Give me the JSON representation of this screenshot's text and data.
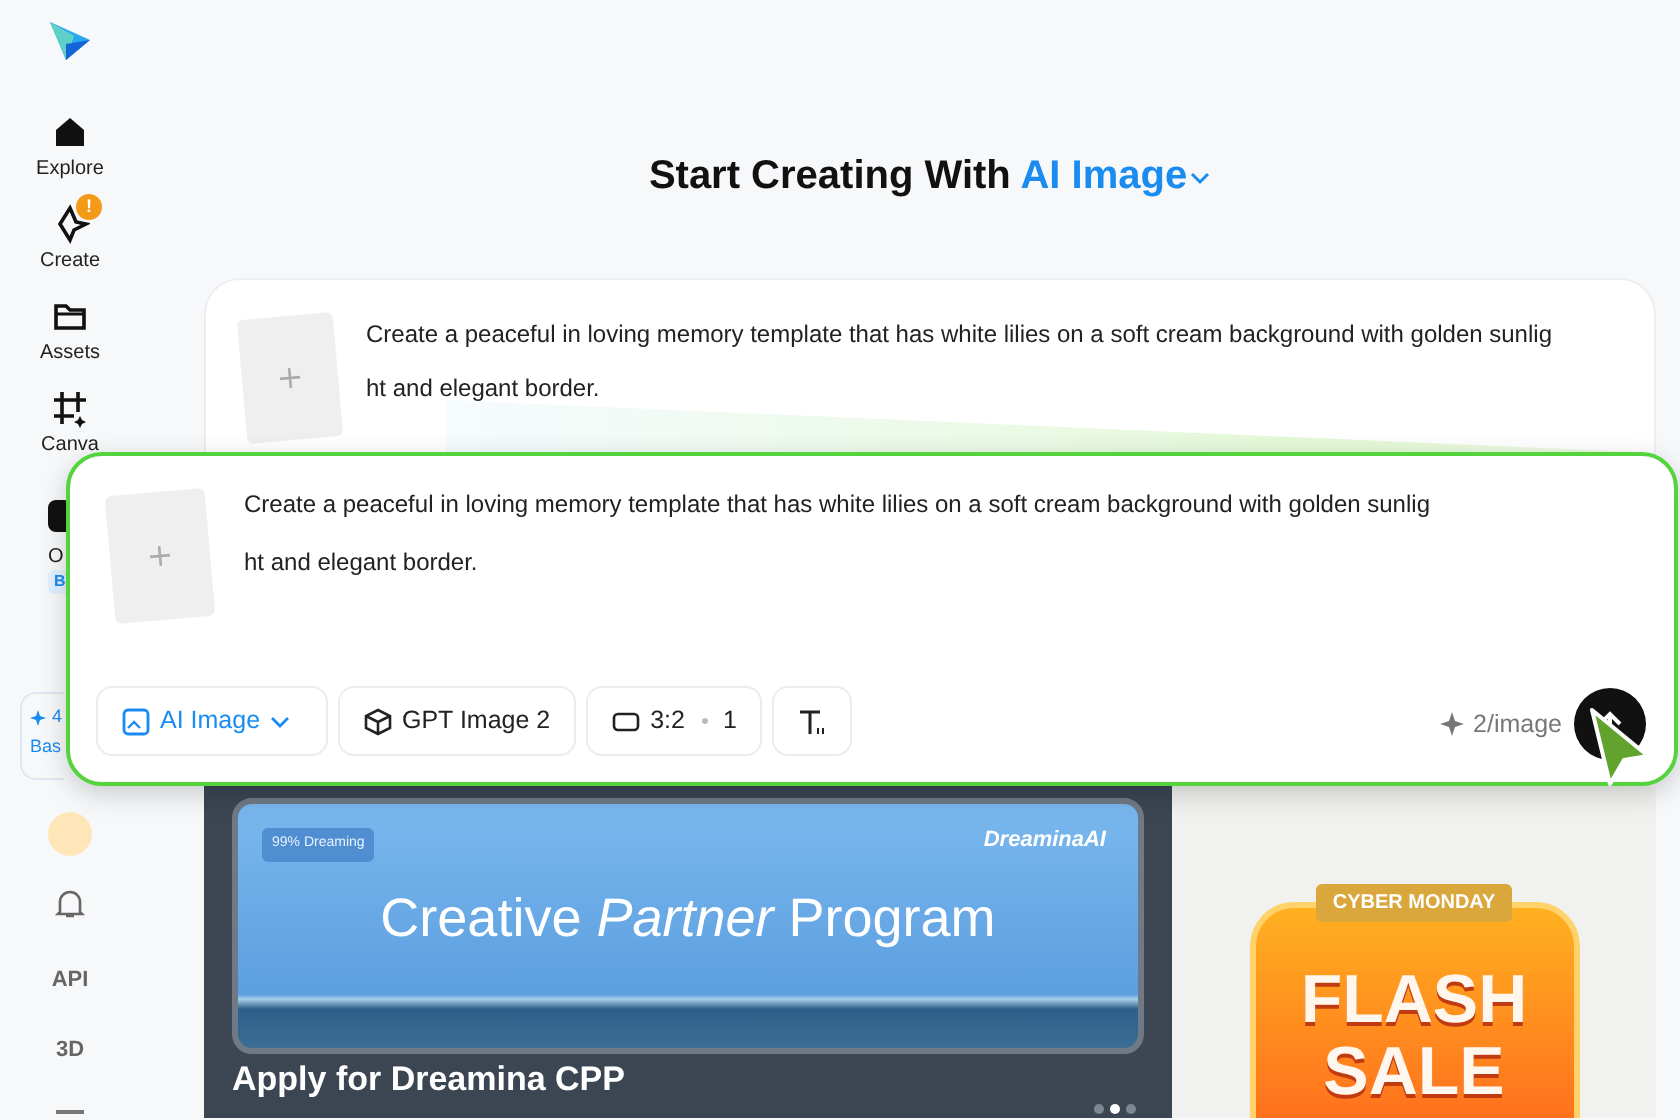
{
  "sidebar": {
    "nav": [
      {
        "label": "Explore"
      },
      {
        "label": "Create",
        "badge": "!"
      },
      {
        "label": "Assets"
      },
      {
        "label": "Canva"
      },
      {
        "label": "O",
        "badge": "B"
      }
    ],
    "credits": {
      "value": "4",
      "plan": "Bas"
    },
    "bottom": [
      "API",
      "3D"
    ]
  },
  "heading": {
    "text": "Start Creating With",
    "mode": "AI Image"
  },
  "prompt_card": {
    "lines": [
      "Create a peaceful in loving memory template that has white lilies on a soft cream background with golden sunlig",
      "ht and elegant border."
    ]
  },
  "composer": {
    "lines": [
      "Create a peaceful in loving memory template that has white lilies on a soft cream background with golden sunlig",
      "ht and elegant border."
    ],
    "chips": [
      {
        "kind": "mode",
        "label": "AI Image"
      },
      {
        "kind": "model",
        "label": "GPT Image 2"
      },
      {
        "kind": "ratio",
        "label": "3:2",
        "count": "1"
      },
      {
        "kind": "text"
      }
    ],
    "cost": "2/image"
  },
  "banners": [
    {
      "kind": "promo",
      "tag": "99% Dreaming",
      "brand": "DreaminaAI",
      "headline": "Creative *Partner* Program",
      "caption": "Apply for Dreamina CPP",
      "dots": [
        {
          "selected": false
        },
        {
          "selected": true
        },
        {
          "selected": false
        }
      ]
    },
    {
      "kind": "sale",
      "ribbon": "CYBER MONDAY",
      "lines": [
        "FLASH",
        "SALE"
      ]
    }
  ]
}
